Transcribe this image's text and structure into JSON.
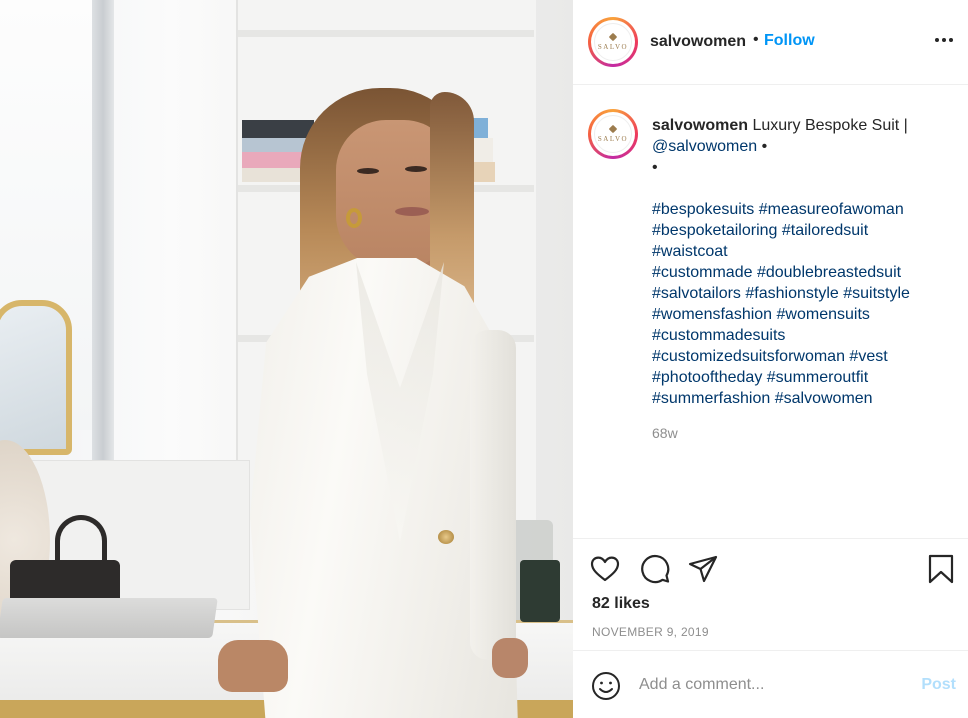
{
  "post": {
    "username": "salvowomen",
    "avatar_text": "SALVO",
    "follow_label": "Follow",
    "separator": "•",
    "caption": {
      "text": "Luxury Bespoke Suit |",
      "mention": "@salvowomen",
      "bullet_1": "•",
      "bullet_2": "•",
      "hashtag_lines": [
        "#bespokesuits #measureofawoman",
        "#bespoketailoring #tailoredsuit",
        "#waistcoat",
        "#custommade #doublebreastedsuit",
        "#salvotailors #fashionstyle #suitstyle",
        "#womensfashion #womensuits",
        "#custommadesuits",
        "#customizedsuitsforwoman #vest",
        "#photooftheday #summeroutfit",
        "#summerfashion #salvowomen"
      ]
    },
    "time_ago": "68w",
    "likes": "82 likes",
    "date": "NOVEMBER 9, 2019"
  },
  "icons": {
    "more": "more-options-icon",
    "like": "heart-icon",
    "comment": "comment-icon",
    "share": "paper-plane-icon",
    "save": "bookmark-icon",
    "emoji": "emoji-smile-icon"
  },
  "comment_box": {
    "placeholder": "Add a comment...",
    "post_label": "Post"
  },
  "colors": {
    "link_blue": "#0095f6",
    "hashtag": "#00376b",
    "muted": "#8e8e8e",
    "post_disabled": "#b2dffc"
  }
}
